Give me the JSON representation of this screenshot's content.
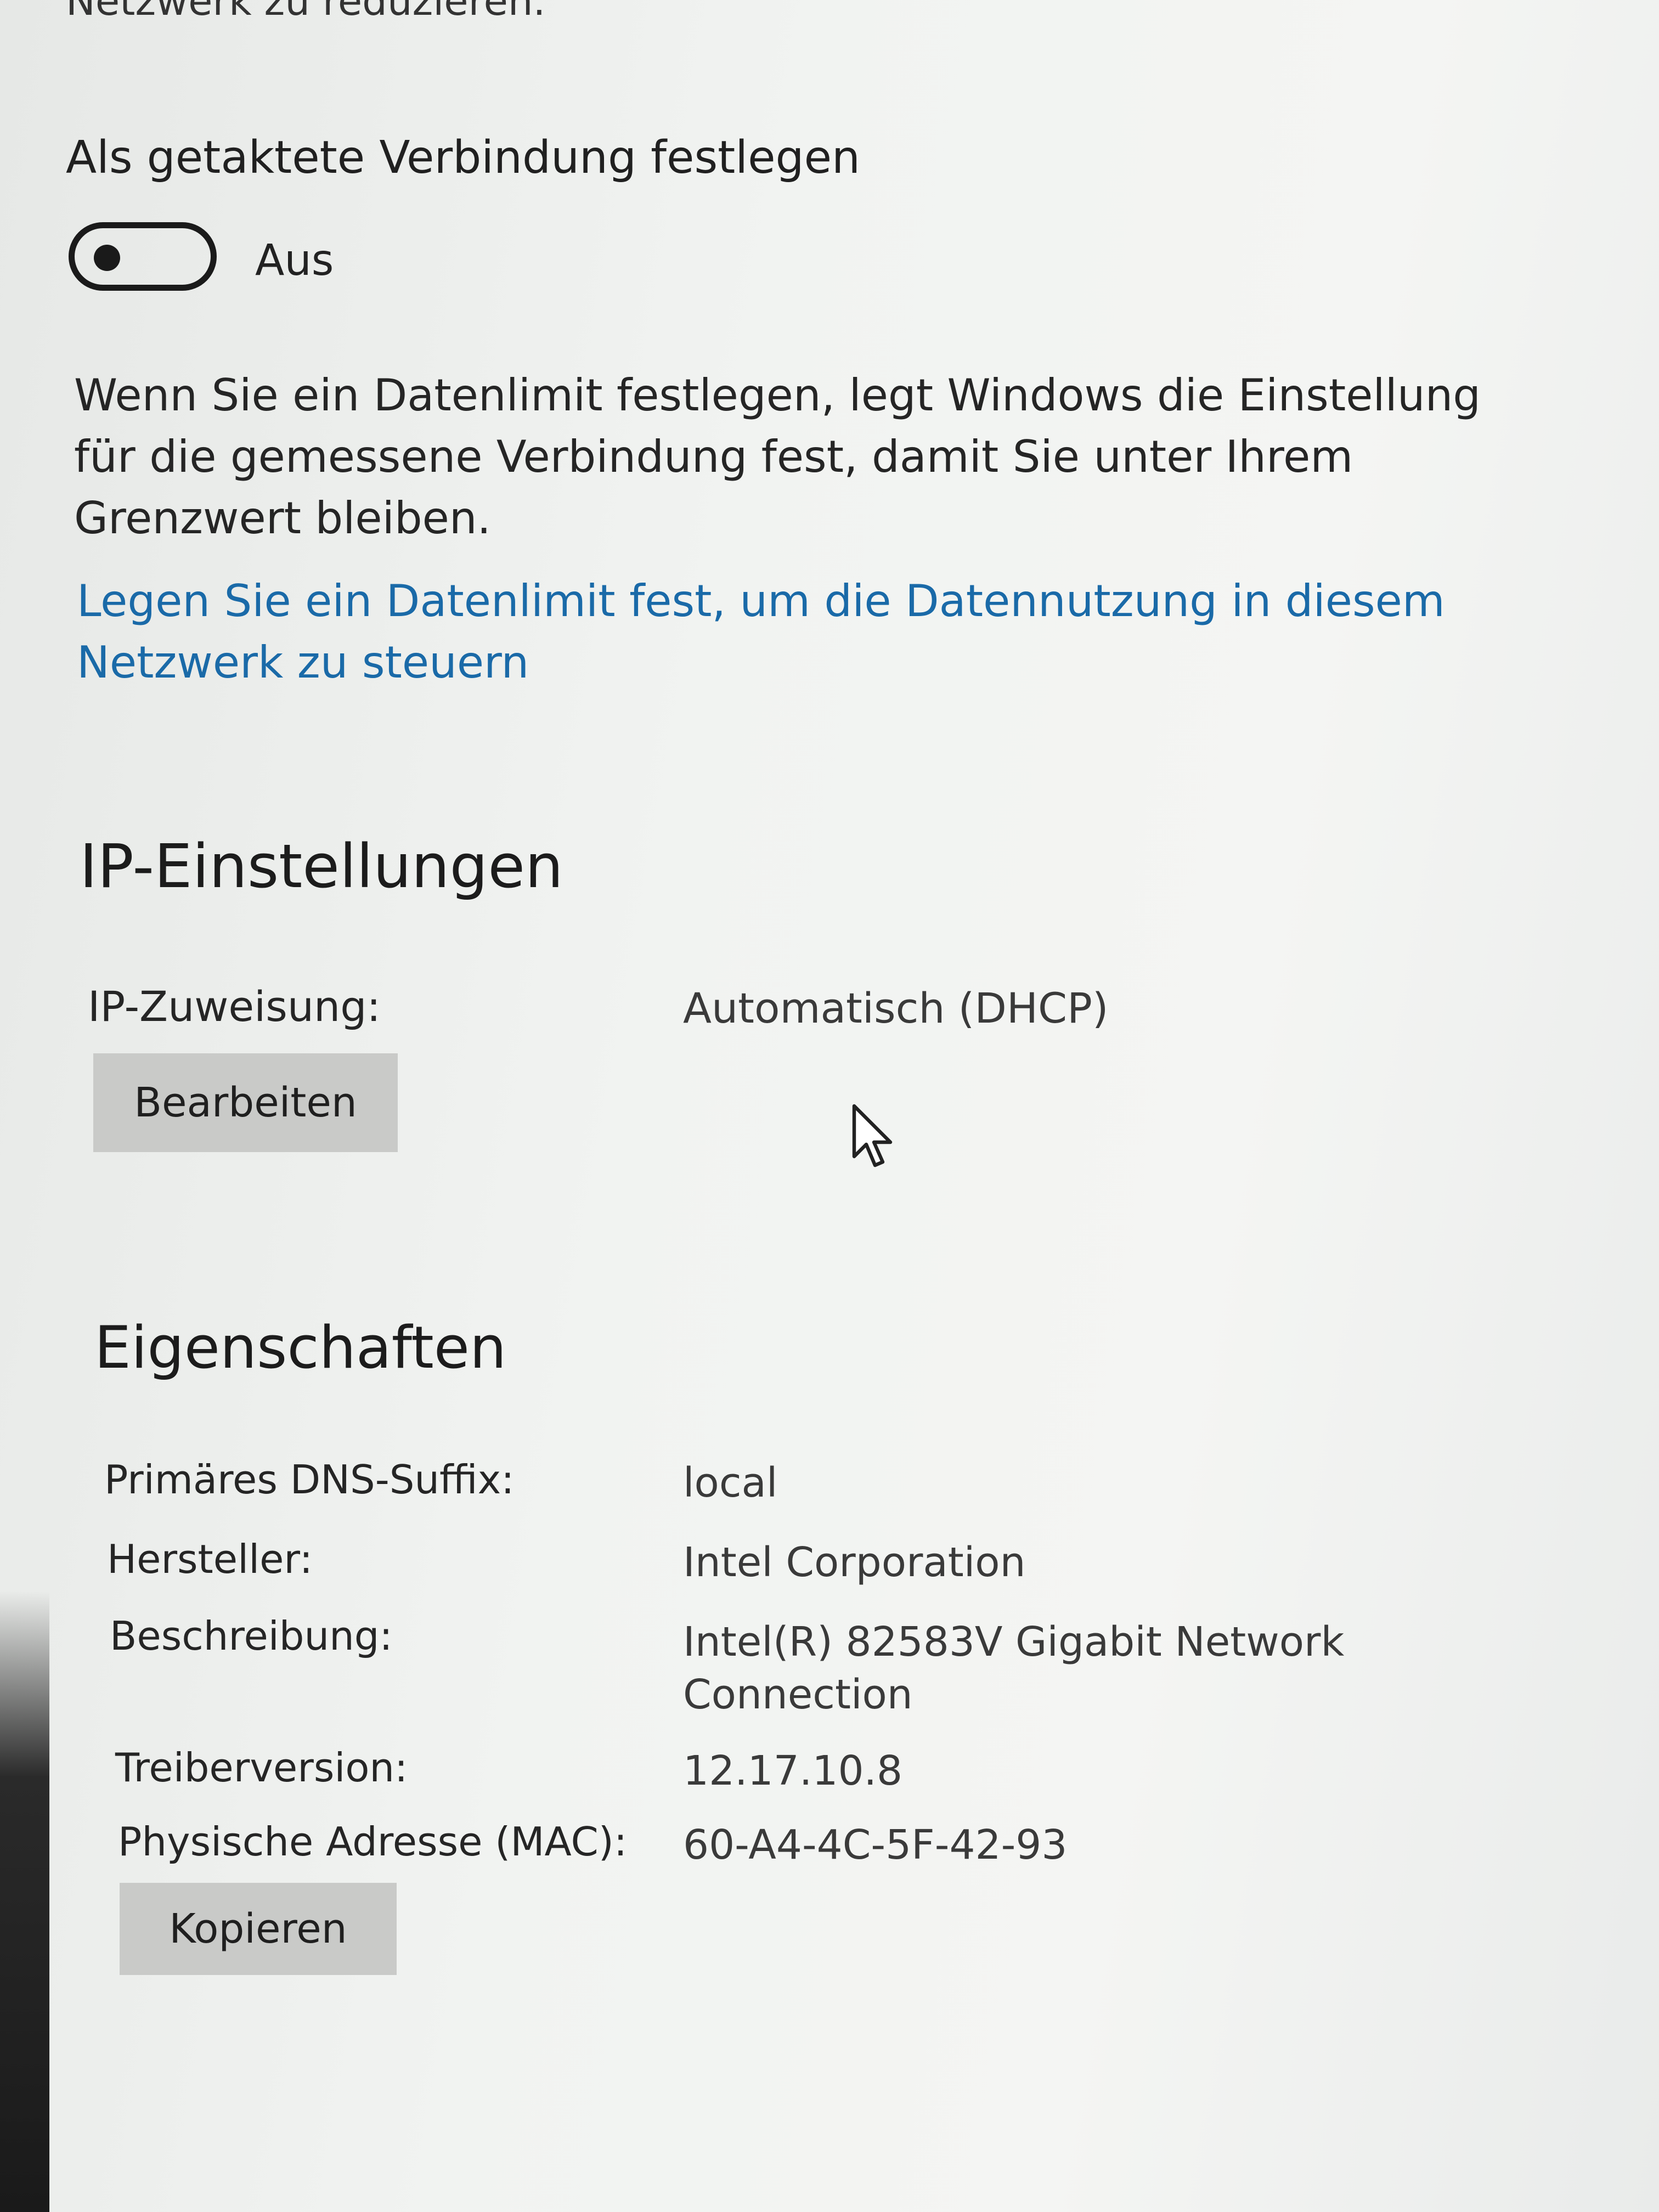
{
  "top_partial_text": "Netzwerk zu reduzieren.",
  "metered": {
    "label": "Als getaktete Verbindung festlegen",
    "state": "Aus",
    "description": "Wenn Sie ein Datenlimit festlegen, legt Windows die Einstellung für die gemessene Verbindung fest, damit Sie unter Ihrem Grenzwert bleiben.",
    "link": "Legen Sie ein Datenlimit fest, um die Datennutzung in diesem Netzwerk zu steuern"
  },
  "ip_settings": {
    "heading": "IP-Einstellungen",
    "assignment_label": "IP-Zuweisung:",
    "assignment_value": "Automatisch (DHCP)",
    "edit_button": "Bearbeiten"
  },
  "properties": {
    "heading": "Eigenschaften",
    "rows": [
      {
        "label": "Primäres DNS-Suffix:",
        "value": "local"
      },
      {
        "label": "Hersteller:",
        "value": "Intel Corporation"
      },
      {
        "label": "Beschreibung:",
        "value": "Intel(R) 82583V Gigabit Network Connection"
      },
      {
        "label": "Treiberversion:",
        "value": "12.17.10.8"
      },
      {
        "label": "Physische Adresse (MAC):",
        "value": "60-A4-4C-5F-42-93"
      }
    ],
    "copy_button": "Kopieren"
  },
  "icons": {
    "cursor": "mouse-pointer-icon"
  }
}
